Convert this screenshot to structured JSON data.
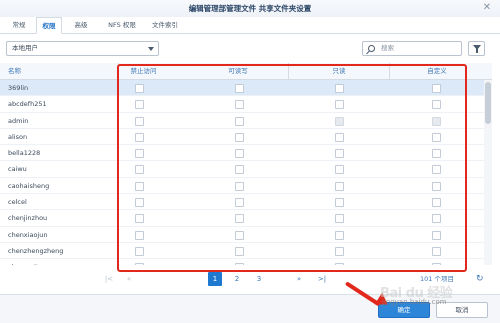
{
  "window": {
    "title": "编辑管理部管理文件 共享文件夹设置"
  },
  "tabs": [
    {
      "label": "常规",
      "active": false
    },
    {
      "label": "权限",
      "active": true
    },
    {
      "label": "高级",
      "active": false
    },
    {
      "label": "NFS 权限",
      "active": false
    },
    {
      "label": "文件索引",
      "active": false
    }
  ],
  "toolbar": {
    "user_type": "本地用户",
    "search_placeholder": "搜索"
  },
  "table": {
    "columns": [
      "名称",
      "禁止访问",
      "可读写",
      "只读",
      "自定义"
    ],
    "rows": [
      {
        "name": "369lin",
        "selected": true
      },
      {
        "name": "abcdefh251",
        "selected": false
      },
      {
        "name": "admin",
        "selected": false
      },
      {
        "name": "alison",
        "selected": false
      },
      {
        "name": "bella1228",
        "selected": false
      },
      {
        "name": "caiwu",
        "selected": false
      },
      {
        "name": "caohaisheng",
        "selected": false
      },
      {
        "name": "celcel",
        "selected": false
      },
      {
        "name": "chenjinzhou",
        "selected": false
      },
      {
        "name": "chenxiaojun",
        "selected": false
      },
      {
        "name": "chenzhengzheng",
        "selected": false
      },
      {
        "name": "clausewit",
        "selected": false
      }
    ]
  },
  "pager": {
    "pages": [
      "1",
      "2",
      "3"
    ],
    "current": "1",
    "count_text": "101 个项目"
  },
  "footer": {
    "ok_label": "确定",
    "cancel_label": "取消"
  },
  "watermark": {
    "brand": "Bai du 经验",
    "url": "jingyan.baidu.com"
  },
  "colors": {
    "accent": "#1f79d0",
    "annotation": "#e2271c"
  }
}
